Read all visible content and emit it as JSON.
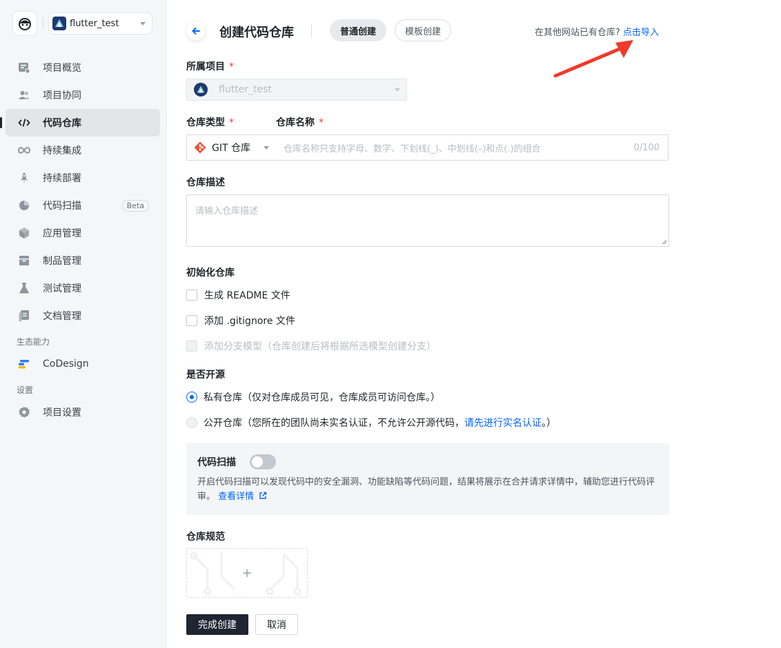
{
  "sidebar": {
    "project_name": "flutter_test",
    "items": [
      {
        "label": "项目概览",
        "icon": "overview-icon"
      },
      {
        "label": "项目协同",
        "icon": "team-icon"
      },
      {
        "label": "代码仓库",
        "icon": "code-icon",
        "active": true
      },
      {
        "label": "持续集成",
        "icon": "infinity-icon"
      },
      {
        "label": "持续部署",
        "icon": "rocket-icon"
      },
      {
        "label": "代码扫描",
        "icon": "pie-icon",
        "badge": "Beta"
      },
      {
        "label": "应用管理",
        "icon": "box-icon"
      },
      {
        "label": "制品管理",
        "icon": "archive-icon"
      },
      {
        "label": "测试管理",
        "icon": "flask-icon"
      },
      {
        "label": "文档管理",
        "icon": "doc-icon"
      }
    ],
    "eco_title": "生态能力",
    "eco_item": "CoDesign",
    "settings_title": "设置",
    "settings_item": "项目设置"
  },
  "header": {
    "title": "创建代码仓库",
    "tab_normal": "普通创建",
    "tab_template": "模板创建",
    "import_hint": "在其他网站已有仓库?",
    "import_link": "点击导入"
  },
  "form": {
    "project_label": "所属项目",
    "project_value": "flutter_test",
    "type_label": "仓库类型",
    "type_value": "GIT 仓库",
    "name_label": "仓库名称",
    "name_placeholder": "仓库名称只支持字母、数字、下划线(_)、中划线(–)和点(.)的组合",
    "name_counter": "0/100",
    "required_mark": "*",
    "desc_label": "仓库描述",
    "desc_placeholder": "请输入仓库描述",
    "init_label": "初始化仓库",
    "init_readme": "生成 README 文件",
    "init_gitignore": "添加 .gitignore 文件",
    "init_branch": "添加分支模型（仓库创建后将根据所选模型创建分支）",
    "open_label": "是否开源",
    "private_text": "私有仓库（仅对仓库成员可见，仓库成员可访问仓库。）",
    "public_text": "公开仓库（您所在的团队尚未实名认证，不允许公开源代码，",
    "public_link": "请先进行实名认证",
    "public_tail": "。）",
    "scan_title": "代码扫描",
    "scan_desc": "开启代码扫描可以发现代码中的安全漏洞、功能缺陷等代码问题，结果将展示在合并请求详情中，辅助您进行代码评审。",
    "scan_link": "查看详情",
    "spec_label": "仓库规范",
    "upload_plus": "+",
    "submit": "完成创建",
    "cancel": "取消"
  },
  "colors": {
    "accent": "#0066ff",
    "required": "#f23c3c",
    "primary_button": "#1f2631",
    "annotation_arrow": "#f03a2a"
  }
}
